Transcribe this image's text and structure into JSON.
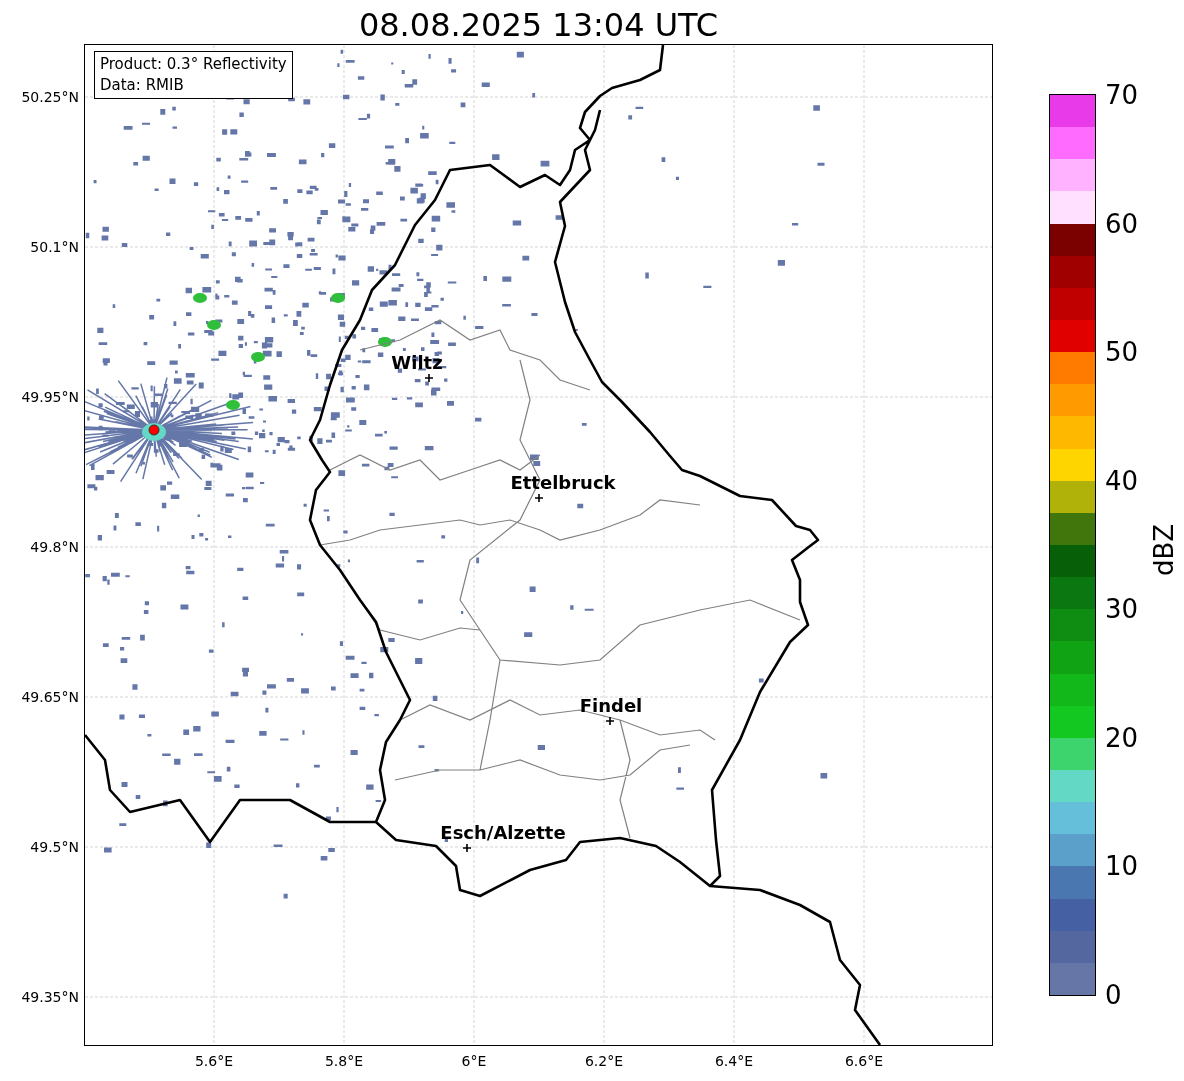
{
  "title": "08.08.2025 13:04 UTC",
  "legend": {
    "lines": [
      "Product: 0.3° Reflectivity",
      "Data: RMIB"
    ]
  },
  "map": {
    "x_ticks": [
      "5.6°E",
      "5.8°E",
      "6°E",
      "6.2°E",
      "6.4°E",
      "6.6°E"
    ],
    "y_ticks": [
      "50.25°N",
      "50.1°N",
      "49.95°N",
      "49.8°N",
      "49.65°N",
      "49.5°N",
      "49.35°N"
    ],
    "places": [
      {
        "name": "Wiltz"
      },
      {
        "name": "Ettelbruck"
      },
      {
        "name": "Findel"
      },
      {
        "name": "Esch/Alzette"
      }
    ]
  },
  "colorbar": {
    "label": "dBZ",
    "ticks": [
      "70",
      "60",
      "50",
      "40",
      "30",
      "20",
      "10",
      "0"
    ],
    "bins": [
      {
        "color": "#e83ae8"
      },
      {
        "color": "#ff6bff"
      },
      {
        "color": "#ffb2ff"
      },
      {
        "color": "#ffe0ff"
      },
      {
        "color": "#7b0000"
      },
      {
        "color": "#a00000"
      },
      {
        "color": "#c00000"
      },
      {
        "color": "#e00000"
      },
      {
        "color": "#ff7b00"
      },
      {
        "color": "#ff9a00"
      },
      {
        "color": "#ffb800"
      },
      {
        "color": "#ffd500"
      },
      {
        "color": "#b0b20a"
      },
      {
        "color": "#41760c"
      },
      {
        "color": "#075f08"
      },
      {
        "color": "#0a7710"
      },
      {
        "color": "#0f8c12"
      },
      {
        "color": "#10a314"
      },
      {
        "color": "#12b81a"
      },
      {
        "color": "#13c820"
      },
      {
        "color": "#3dd46e"
      },
      {
        "color": "#63d8c4"
      },
      {
        "color": "#65bfda"
      },
      {
        "color": "#5ba0cb"
      },
      {
        "color": "#4a77b0"
      },
      {
        "color": "#4560a3"
      },
      {
        "color": "#54689f"
      },
      {
        "color": "#6677a7"
      }
    ]
  }
}
